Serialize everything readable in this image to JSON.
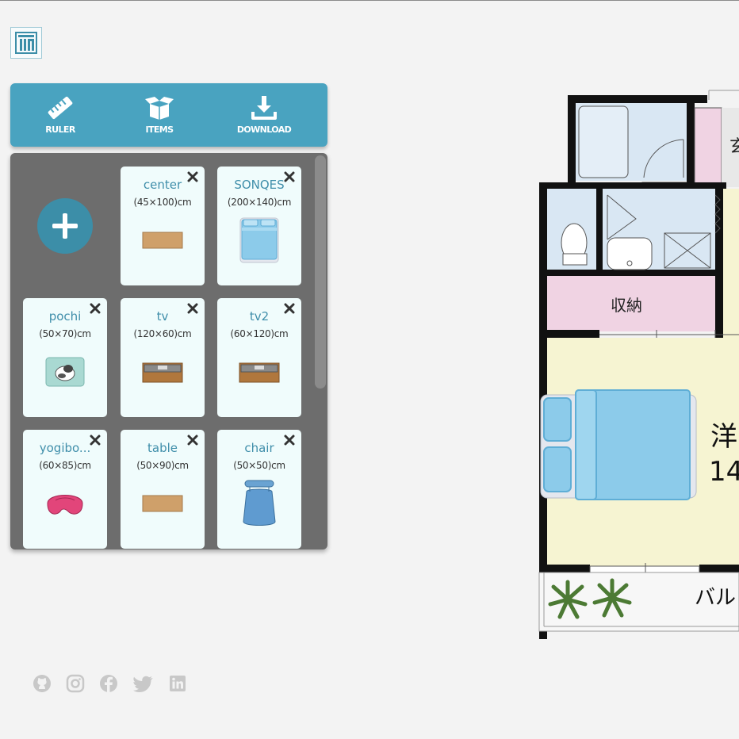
{
  "toolbar": {
    "ruler_label": "RULER",
    "items_label": "ITEMS",
    "download_label": "DOWNLOAD"
  },
  "items": [
    {
      "name": "center",
      "dims": "(45×100)cm"
    },
    {
      "name": "SONQES",
      "dims": "(200×140)cm"
    },
    {
      "name": "pochi",
      "dims": "(50×70)cm"
    },
    {
      "name": "tv",
      "dims": "(120×60)cm"
    },
    {
      "name": "tv2",
      "dims": "(60×120)cm"
    },
    {
      "name": "yogibo...",
      "dims": "(60×85)cm"
    },
    {
      "name": "table",
      "dims": "(50×90)cm"
    },
    {
      "name": "chair",
      "dims": "(50×50)cm"
    }
  ],
  "floorplan": {
    "storage_label": "収納",
    "room_label_1": "洋",
    "room_label_2": "14",
    "balcony_label": "バル",
    "entrance_label": "玄"
  },
  "social_icons": [
    "github-icon",
    "instagram-icon",
    "facebook-icon",
    "twitter-icon",
    "linkedin-icon"
  ],
  "colors": {
    "accent": "#49a3c0",
    "panel": "#6d6d6d",
    "card": "#f0fcfc",
    "room_floor": "#f6f4d2",
    "storage": "#f0d3e3",
    "bath": "#d9e7f3"
  }
}
